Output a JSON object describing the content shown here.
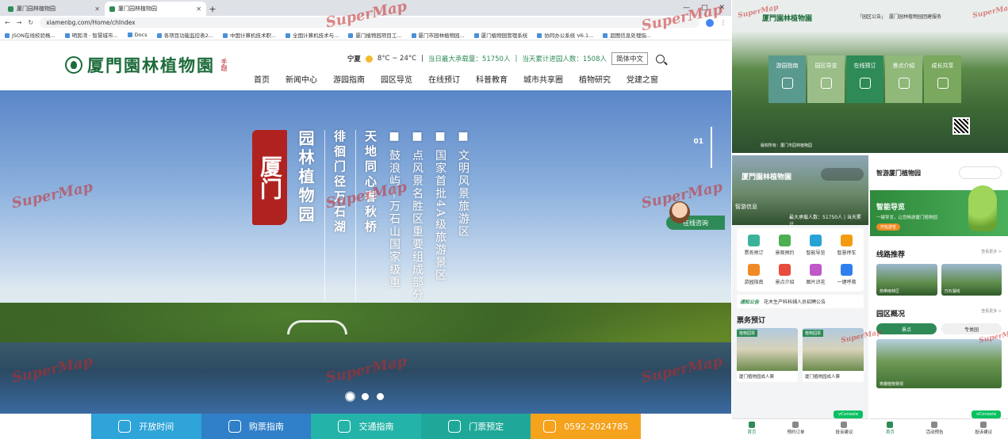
{
  "browser": {
    "tabs": [
      {
        "title": "厦门园林植物园"
      },
      {
        "title": "厦门园林植物园"
      }
    ],
    "new_tab": "+",
    "window_controls": [
      "—",
      "□",
      "✕"
    ],
    "url": "xiamenbg.com/Home/chIndex",
    "bookmarks": [
      "JSON在线校验格...",
      "明民湾 · 智慧城市...",
      "Docs",
      "各项目功能监控表2...",
      "中国计算机技术职...",
      "全国计算机技术与...",
      "厦门植物园项目工...",
      "厦门市园林植物园...",
      "厦门植物园管理系统",
      "协同办公系统 V6.1...",
      "超图信息处理指..."
    ]
  },
  "site": {
    "logo_text": "厦門園林植物園",
    "logo_seal": "手题",
    "weather_city": "宁夏",
    "weather_temp": "8°C ~ 24°C",
    "max_capacity": "当日最大承载量：51750人",
    "visitors": "当天累计进园人数：1508人",
    "lang_button": "简体中文",
    "nav": [
      "首页",
      "新闻中心",
      "游园指南",
      "园区导览",
      "在线预订",
      "科普教育",
      "城市共享圈",
      "植物研究",
      "党建之窗"
    ]
  },
  "hero": {
    "seal": "厦门",
    "title": "园林植物园",
    "lines": [
      "徘徊门径万石湖",
      "天地同心春秋桥",
      "■ 鼓浪屿—万石山国家级重",
      "■ 点风景名胜区重要组成部分",
      "■ 国家首批4A级旅游景区",
      "■ 文明风景旅游区"
    ],
    "slide_counter": "01",
    "chat_label": "在线咨询"
  },
  "quickbar": [
    {
      "label": "开放时间",
      "color": "#2fa4d8"
    },
    {
      "label": "购票指南",
      "color": "#2f7fc9"
    },
    {
      "label": "交通指南",
      "color": "#24b3a8"
    },
    {
      "label": "门票预定",
      "color": "#1fa89a"
    },
    {
      "label": "0592-2024785",
      "color": "#f5a21c"
    }
  ],
  "watermark": "SuperMap",
  "panel1": {
    "logo": "厦門園林植物園",
    "toplinks": [
      "「园区公告」",
      "厦门园林植物园团建服务"
    ],
    "cards": [
      {
        "label": "游园指南",
        "color": "#5a9a8e"
      },
      {
        "label": "园区导览",
        "color": "#9bbd88"
      },
      {
        "label": "在线预订",
        "color": "#2e8b57"
      },
      {
        "label": "景点介绍",
        "color": "#8fb879"
      },
      {
        "label": "成长共享",
        "color": "#7aa85e"
      }
    ],
    "footer": "版权所有：厦门市园林植物园"
  },
  "panel2": {
    "title": "厦門園林植物園",
    "info": "智游信息",
    "stats": "最大承载人数：51750人 | 当天累计...",
    "grid": [
      {
        "label": "票务预订",
        "color": "#3cb29a"
      },
      {
        "label": "景观预约",
        "color": "#4caf50"
      },
      {
        "label": "智能导览",
        "color": "#29a3d6"
      },
      {
        "label": "智慧停车",
        "color": "#f39c12"
      },
      {
        "label": "游园指南",
        "color": "#f08a24"
      },
      {
        "label": "景点介绍",
        "color": "#e74c3c"
      },
      {
        "label": "图片识花",
        "color": "#c058c8"
      },
      {
        "label": "一键呼救",
        "color": "#2f80ed"
      }
    ],
    "notice_label": "通知公告",
    "notice_text": "花木生产科科辅人员招聘公告",
    "section": "票务预订",
    "tickets": [
      {
        "tag": "植物园票",
        "caption": "厦门植物园成人票"
      },
      {
        "tag": "植物园票",
        "caption": "厦门植物园成人票"
      }
    ],
    "vconsole": "vConsole",
    "tabbar": [
      "首页",
      "预约订单",
      "投诉建议"
    ]
  },
  "panel3": {
    "title": "智游厦门植物园",
    "banner_title": "智能导览",
    "banner_sub": "一键导览，让您畅游厦门植物园",
    "banner_btn": "开始游览",
    "routes_title": "线路推荐",
    "routes_more": "查看更多 >",
    "routes": [
      "热带雨林区",
      "万石湖线"
    ],
    "overview_title": "园区概况",
    "overview_more": "查看更多 >",
    "overview_tabs": [
      "景点",
      "专类园"
    ],
    "overview_caption": "奇趣植物景观",
    "vconsole": "vConsole",
    "tabbar": [
      "首页",
      "活动预告",
      "投诉建议"
    ]
  }
}
